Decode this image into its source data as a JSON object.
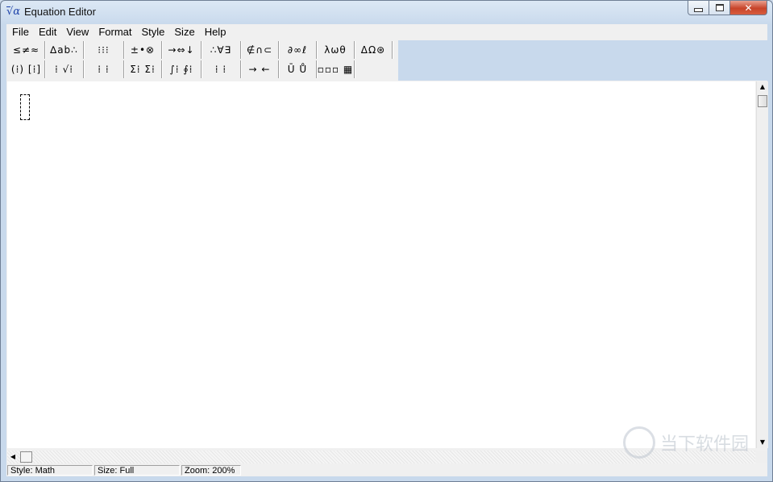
{
  "window": {
    "title": "Equation Editor",
    "icon_glyph": "√α",
    "close_glyph": "✕"
  },
  "menubar": {
    "items": [
      "File",
      "Edit",
      "View",
      "Format",
      "Style",
      "Size",
      "Help"
    ]
  },
  "toolbar": {
    "row1": [
      {
        "name": "relational-symbols",
        "label": "≤≠≈"
      },
      {
        "name": "spaces-ellipses",
        "label": "∆ab∴"
      },
      {
        "name": "embellishments",
        "label": "⁝⁝⁝"
      },
      {
        "name": "operator-symbols",
        "label": "±•⊗"
      },
      {
        "name": "arrow-symbols",
        "label": "→⇔↓"
      },
      {
        "name": "logical-symbols",
        "label": "∴∀∃"
      },
      {
        "name": "set-theory-symbols",
        "label": "∉∩⊂"
      },
      {
        "name": "misc-symbols",
        "label": "∂∞ℓ"
      },
      {
        "name": "greek-lowercase",
        "label": "λωθ"
      },
      {
        "name": "greek-uppercase",
        "label": "ΔΩ⊛"
      }
    ],
    "row2": [
      {
        "name": "fence-templates",
        "label": "(⁞) [⁞]"
      },
      {
        "name": "fraction-radical-templates",
        "label": "⁞ √⁞"
      },
      {
        "name": "subscript-superscript-templates",
        "label": "⁞ ⁞"
      },
      {
        "name": "summation-templates",
        "label": "Σ⁞ Σ⁞"
      },
      {
        "name": "integral-templates",
        "label": "∫⁞ ∮⁞"
      },
      {
        "name": "underbar-overbar-templates",
        "label": "⁞ ⁞"
      },
      {
        "name": "labeled-arrow-templates",
        "label": "→ ←"
      },
      {
        "name": "product-templates",
        "label": "Ū Ů"
      },
      {
        "name": "matrix-templates",
        "label": "▫▫▫ ▦"
      }
    ]
  },
  "statusbar": {
    "style": "Style: Math",
    "size": "Size: Full",
    "zoom": "Zoom: 200%"
  },
  "watermark": {
    "text": "当下软件园"
  }
}
